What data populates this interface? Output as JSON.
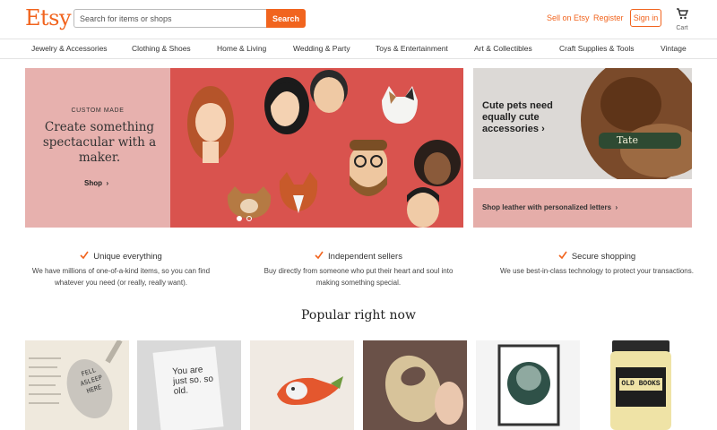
{
  "header": {
    "logo": "Etsy",
    "search": {
      "placeholder": "Search for items or shops",
      "button_label": "Search"
    },
    "sell_link": "Sell on Etsy",
    "register_link": "Register",
    "signin_label": "Sign in",
    "cart_label": "Cart"
  },
  "categories": [
    "Jewelry & Accessories",
    "Clothing & Shoes",
    "Home & Living",
    "Wedding & Party",
    "Toys & Entertainment",
    "Art & Collectibles",
    "Craft Supplies & Tools",
    "Vintage"
  ],
  "hero": {
    "eyebrow": "CUSTOM MADE",
    "title": "Create something spectacular with a maker.",
    "shop_label": "Shop"
  },
  "side_promo_top": {
    "title": "Cute pets need equally cute accessories",
    "collar_text": "Tate"
  },
  "side_promo_bottom": {
    "label": "Shop leather with personalized letters"
  },
  "value_props": [
    {
      "title": "Unique everything",
      "text": "We have millions of one-of-a-kind items, so you can find whatever you need (or really, really want)."
    },
    {
      "title": "Independent sellers",
      "text": "Buy directly from someone who put their heart and soul into making something special."
    },
    {
      "title": "Secure shopping",
      "text": "We use best-in-class technology to protect your transactions."
    }
  ],
  "popular_heading": "Popular right now",
  "popular_items": [
    {
      "image_text": "FELL ASLEEP HERE"
    },
    {
      "image_text": "You are just so. so old."
    },
    {
      "image_text": ""
    },
    {
      "image_text": ""
    },
    {
      "image_text": ""
    },
    {
      "image_text": "OLD BOOKS"
    }
  ],
  "colors": {
    "brand": "#F1641E",
    "hero_left": "#E7B1AE",
    "hero_art": "#D9534E",
    "promo_pink": "#E5ADA9"
  }
}
